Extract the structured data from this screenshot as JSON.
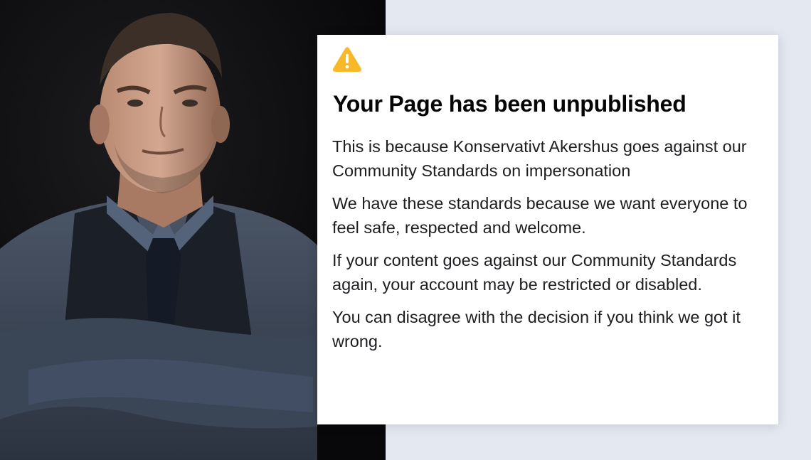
{
  "photo": {
    "subject": "man-in-vest-arms-crossed"
  },
  "notice": {
    "icon": "warning-icon",
    "title": "Your Page has been unpublished",
    "paragraphs": [
      "This is because Konservativt Akershus goes against our Community Standards on impersonation",
      "We have these standards because we want everyone to feel safe, respected and welcome.",
      "If your content goes against our Community Standards again, your account may be restricted or disabled.",
      "You can disagree with the decision if you think we got it wrong."
    ]
  },
  "colors": {
    "warning": "#f7b928",
    "card_background": "#ffffff",
    "page_background": "#e4e8f1",
    "photo_background": "#0c0c0d"
  }
}
